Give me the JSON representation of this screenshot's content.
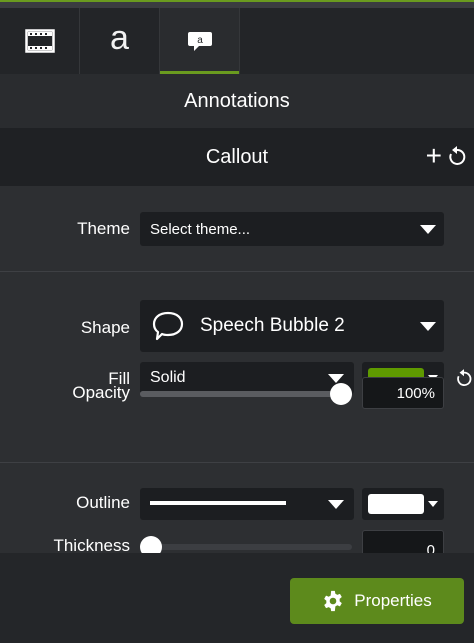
{
  "tabs": [
    {
      "name": "media",
      "icon": "film-strip-icon"
    },
    {
      "name": "text",
      "label": "a"
    },
    {
      "name": "annotations",
      "icon": "callout-icon",
      "icon_label": "a",
      "active": true
    }
  ],
  "section": {
    "title": "Annotations"
  },
  "callout": {
    "title": "Callout",
    "add_icon": "plus-icon",
    "reset_icon": "reset-icon"
  },
  "theme": {
    "label": "Theme",
    "value": "Select theme..."
  },
  "shape": {
    "label": "Shape",
    "value": "Speech Bubble 2",
    "icon": "speech-bubble-icon"
  },
  "fill": {
    "label": "Fill",
    "value": "Solid",
    "color": "#5f9a00",
    "reset_icon": "reset-icon"
  },
  "opacity": {
    "label": "Opacity",
    "value": "100%",
    "level": 1.0
  },
  "outline": {
    "label": "Outline",
    "color": "#ffffff"
  },
  "thickness": {
    "label": "Thickness",
    "value": "0",
    "level": 0.0
  },
  "footer": {
    "properties_label": "Properties",
    "properties_icon": "gear-icon"
  },
  "colors": {
    "accent": "#6a9b1f",
    "button": "#5d8a1c"
  }
}
